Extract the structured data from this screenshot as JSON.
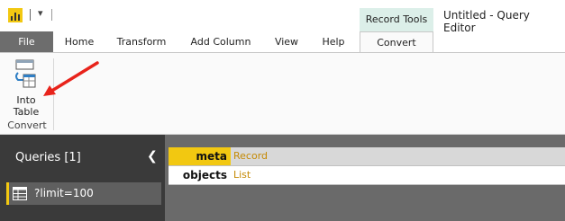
{
  "titlebar": {
    "app_icon": "power-bi-icon",
    "quick_access": "▾",
    "context_group": "Record Tools",
    "window_title": "Untitled - Query Editor"
  },
  "tabs": [
    {
      "label": "File"
    },
    {
      "label": "Home"
    },
    {
      "label": "Transform"
    },
    {
      "label": "Add Column"
    },
    {
      "label": "View"
    },
    {
      "label": "Help"
    },
    {
      "label": "Convert"
    }
  ],
  "ribbon": {
    "into_table_label_line1": "Into",
    "into_table_label_line2": "Table",
    "group_label": "Convert",
    "annotation_arrow_color": "#e8231b"
  },
  "queries": {
    "title": "Queries [1]",
    "collapse_icon": "chevron-left-icon",
    "items": [
      {
        "name": "?limit=100",
        "icon": "table-icon"
      }
    ]
  },
  "record": {
    "rows": [
      {
        "field": "meta",
        "value": "Record"
      },
      {
        "field": "objects",
        "value": "List"
      }
    ]
  },
  "colors": {
    "accent": "#f2c811",
    "context_tab": "#dcefe9",
    "link_value": "#c58a05"
  }
}
